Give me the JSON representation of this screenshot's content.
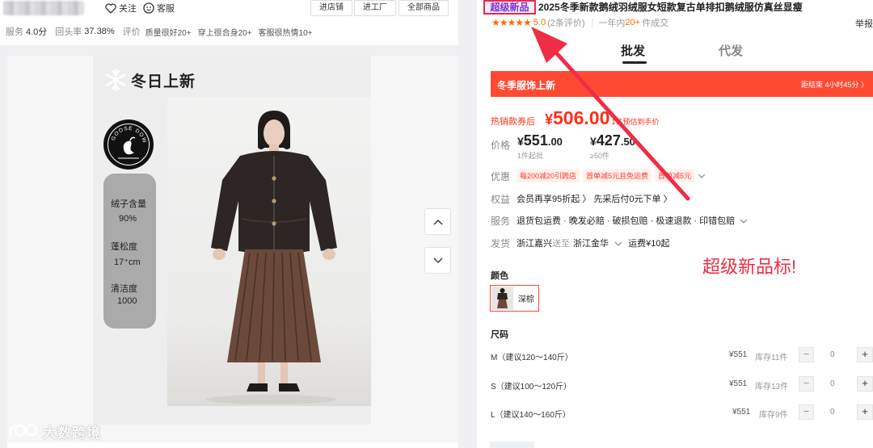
{
  "header": {
    "follow_label": "关注",
    "service_label": "客服",
    "buttons": [
      "进店铺",
      "进工厂",
      "全部商品"
    ]
  },
  "stats": {
    "service_label": "服务",
    "service_value": "4.0分",
    "repurchase_label": "回头率",
    "repurchase_value": "37.38%",
    "review_label": "评价",
    "tags": [
      "质量很好20+",
      "穿上很合身20+",
      "客服很热情10+"
    ]
  },
  "poster": {
    "title": "冬日上新",
    "logo_text": "GOOSE DOWN",
    "specs": [
      {
        "label": "绒子含量",
        "value": "90%"
      },
      {
        "label": "蓬松度",
        "value": "17⁺cm"
      },
      {
        "label": "清洁度",
        "value": "1000"
      }
    ]
  },
  "watermark": "大数跨境",
  "product": {
    "badge": "超级新品",
    "title": "2025冬季新款鹅绒羽绒服女短款复古单排扣鹅绒服仿真丝显瘦",
    "report": "举报",
    "rating_score": "5.0",
    "rating_count": "(2条评价)",
    "year_prefix": "一年内",
    "year_count": "20+",
    "year_suffix": "件成交",
    "tabs": [
      "批发",
      "代发"
    ],
    "promo_left": "冬季服饰上新",
    "promo_right": "距结束 4小时45分 〉",
    "coupon_label": "热销款券后",
    "coupon_currency": "¥",
    "coupon_price": "506.00",
    "coupon_note": "1件预估到手价",
    "price_label": "价格",
    "prices": [
      {
        "currency": "¥",
        "int": "551",
        "dec": ".00",
        "cond": "1件起批"
      },
      {
        "currency": "¥",
        "int": "427",
        "dec": ".50",
        "cond": "≥50件"
      }
    ],
    "discount_label": "优惠",
    "discounts": [
      "每200减20引跨店",
      "首单减5元且免运费",
      "首单减5元"
    ],
    "rights_label": "权益",
    "rights": "会员再享95折起 〉 先采后付0元下单 〉",
    "service_label": "服务",
    "service": "退货包运费 · 晚发必赔 · 破损包赔 · 极速退款 · 印错包赔",
    "ship_label": "发货",
    "ship_from": "浙江嘉兴",
    "ship_to_word": "送至",
    "ship_to": "浙江金华",
    "ship_fee": "运费¥10起",
    "color_heading": "颜色",
    "color_name": "深棕",
    "size_heading": "尺码",
    "sizes": [
      {
        "name": "M（建议120～140斤）",
        "price": "¥551",
        "stock": "库存11件",
        "qty": "0"
      },
      {
        "name": "S（建议100～120斤）",
        "price": "¥551",
        "stock": "库存13件",
        "qty": "0"
      },
      {
        "name": "L（建议140～160斤）",
        "price": "¥551",
        "stock": "库存9件",
        "qty": "0"
      }
    ]
  },
  "annotation": "超级新品标!",
  "colors": {
    "accent": "#ff4a33",
    "badge_border": "#e6294a",
    "badge_text": "#7e2ad6",
    "star": "#ff6a00",
    "annotation": "#ef2d44"
  }
}
